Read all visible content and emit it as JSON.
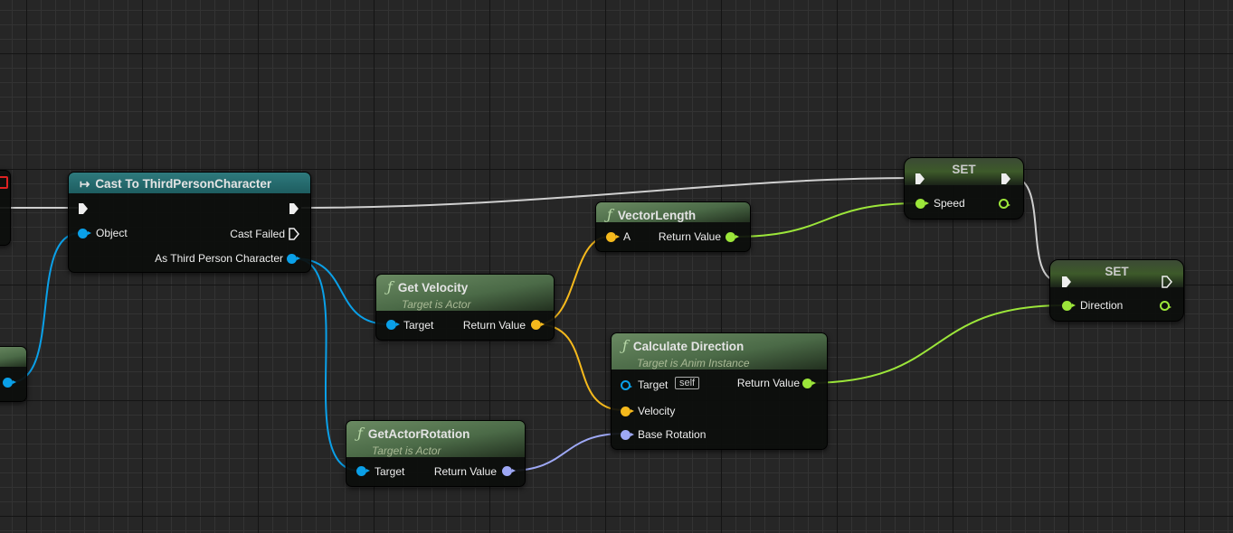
{
  "colors": {
    "exec": "#d8d8d8",
    "object": "#0aa0e8",
    "vector": "#f5b91c",
    "float": "#9ce63a",
    "rotator": "#9ea8f5"
  },
  "nodes": {
    "cast": {
      "title": "Cast To ThirdPersonCharacter",
      "icon": "cast-arrow-icon",
      "pins": {
        "object": "Object",
        "cast_failed": "Cast Failed",
        "as_character": "As Third Person Character"
      }
    },
    "vector_length": {
      "title": "VectorLength",
      "icon": "function-icon",
      "pins": {
        "a": "A",
        "return": "Return Value"
      }
    },
    "get_velocity": {
      "title": "Get Velocity",
      "subtitle": "Target is Actor",
      "pins": {
        "target": "Target",
        "return": "Return Value"
      }
    },
    "calc_direction": {
      "title": "Calculate Direction",
      "subtitle": "Target is Anim Instance",
      "pins": {
        "target": "Target",
        "self": "self",
        "velocity": "Velocity",
        "base_rotation": "Base Rotation",
        "return": "Return Value"
      }
    },
    "get_actor_rotation": {
      "title": "GetActorRotation",
      "subtitle": "Target is Actor",
      "pins": {
        "target": "Target",
        "return": "Return Value"
      }
    },
    "set_speed": {
      "title": "SET",
      "pins": {
        "var": "Speed"
      }
    },
    "set_direction": {
      "title": "SET",
      "pins": {
        "var": "Direction"
      }
    }
  },
  "function_glyph": "ƒ",
  "cast_glyph": "↦"
}
